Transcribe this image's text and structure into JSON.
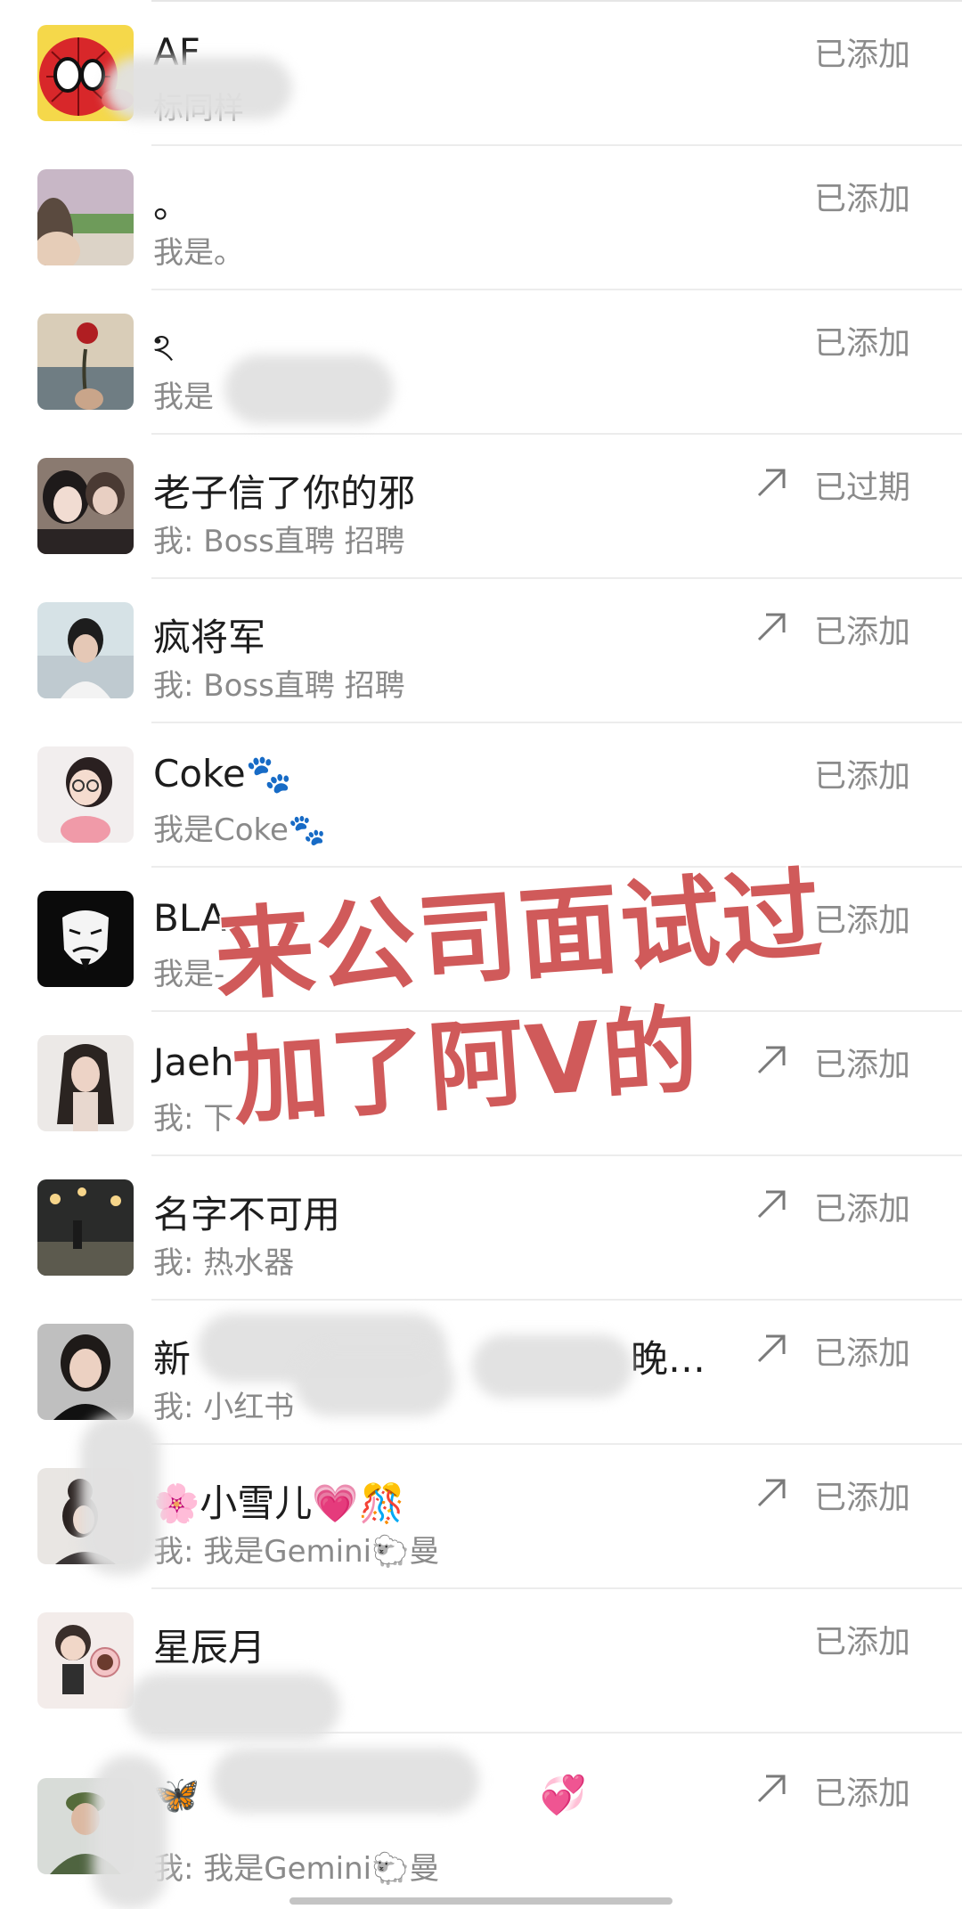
{
  "contacts": [
    {
      "name": "AF",
      "sub": "标同样",
      "status": "已添加",
      "arrow": false
    },
    {
      "name": "。",
      "sub": "我是。",
      "status": "已添加",
      "arrow": false
    },
    {
      "name": "ঽ",
      "sub": "我是",
      "status": "已添加",
      "arrow": false
    },
    {
      "name": "老子信了你的邪",
      "sub": "我: Boss直聘 招聘",
      "status": "已过期",
      "arrow": true
    },
    {
      "name": "疯将军",
      "sub": "我: Boss直聘 招聘",
      "status": "已添加",
      "arrow": true
    },
    {
      "name": "Coke🐾",
      "sub": "我是Coke🐾",
      "status": "已添加",
      "arrow": false
    },
    {
      "name": "BLA",
      "sub": "我是-",
      "status": "已添加",
      "arrow": false
    },
    {
      "name": "Jaeh",
      "sub": "我: 下",
      "status": "已添加",
      "arrow": true
    },
    {
      "name": "名字不可用",
      "sub": "我: 热水器",
      "status": "已添加",
      "arrow": true
    },
    {
      "name": "新",
      "sub": "我: 小红书",
      "status": "已添加",
      "arrow": true,
      "name_tail": "晚…"
    },
    {
      "name": "🌸小雪儿💗🎊",
      "sub": "我: 我是Gemini🐑曼",
      "status": "已添加",
      "arrow": true
    },
    {
      "name": "星辰月",
      "sub": "",
      "status": "已添加",
      "arrow": false
    },
    {
      "name": "🦋",
      "sub": "我: 我是Gemini🐑曼",
      "status": "已添加",
      "arrow": true,
      "name_tail": "💞"
    }
  ],
  "overlay": {
    "line1": "来公司面试过",
    "line2": "加了阿V的"
  },
  "colors": {
    "overlay_text": "#d05a5a",
    "status_text": "#8b8b8b",
    "sub_text": "#8a8a8a"
  }
}
